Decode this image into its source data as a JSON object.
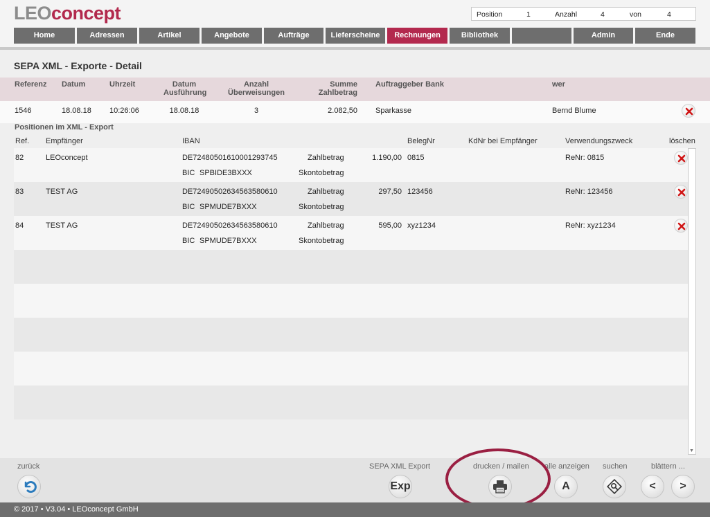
{
  "brand": {
    "leo": "LEO",
    "concept": "concept"
  },
  "info": {
    "position_label": "Position",
    "position_value": "1",
    "anzahl_label": "Anzahl",
    "anzahl_value": "4",
    "von_label": "von",
    "von_value": "4"
  },
  "nav": {
    "home": "Home",
    "adressen": "Adressen",
    "artikel": "Artikel",
    "angebote": "Angebote",
    "auftraege": "Aufträge",
    "lieferscheine": "Lieferscheine",
    "rechnungen": "Rechnungen",
    "bibliothek": "Bibliothek",
    "admin": "Admin",
    "ende": "Ende"
  },
  "page_title": "SEPA XML - Exporte - Detail",
  "export_header": {
    "referenz": "Referenz",
    "datum": "Datum",
    "uhrzeit": "Uhrzeit",
    "datum_ausfuehrung_1": "Datum",
    "datum_ausfuehrung_2": "Ausführung",
    "anzahl_1": "Anzahl",
    "anzahl_2": "Überweisungen",
    "summe_1": "Summe",
    "summe_2": "Zahlbetrag",
    "bank": "Auftraggeber Bank",
    "wer": "wer"
  },
  "export_row": {
    "referenz": "1546",
    "datum": "18.08.18",
    "uhrzeit": "10:26:06",
    "ausfuehrung": "18.08.18",
    "anzahl": "3",
    "summe": "2.082,50",
    "bank": "Sparkasse",
    "wer": "Bernd Blume"
  },
  "positions_title": "Positionen im XML - Export",
  "positions_header": {
    "ref": "Ref.",
    "empfaenger": "Empfänger",
    "iban": "IBAN",
    "belegnr": "BelegNr",
    "kdnr": "KdNr bei Empfänger",
    "verwendungszweck": "Verwendungszweck",
    "loeschen": "löschen"
  },
  "positions": [
    {
      "ref": "82",
      "empfaenger": "LEOconcept",
      "iban": "DE72480501610001293745",
      "bic_label": "BIC",
      "bic": "SPBIDE3BXXX",
      "zahlbetrag_label": "Zahlbetrag",
      "zahlbetrag": "1.190,00",
      "skonto_label": "Skontobetrag",
      "belegnr": "0815",
      "verwendungszweck": "ReNr: 0815"
    },
    {
      "ref": "83",
      "empfaenger": "TEST AG",
      "iban": "DE72490502634563580610",
      "bic_label": "BIC",
      "bic": "SPMUDE7BXXX",
      "zahlbetrag_label": "Zahlbetrag",
      "zahlbetrag": "297,50",
      "skonto_label": "Skontobetrag",
      "belegnr": "123456",
      "verwendungszweck": "ReNr: 123456"
    },
    {
      "ref": "84",
      "empfaenger": "TEST AG",
      "iban": "DE72490502634563580610",
      "bic_label": "BIC",
      "bic": "SPMUDE7BXXX",
      "zahlbetrag_label": "Zahlbetrag",
      "zahlbetrag": "595,00",
      "skonto_label": "Skontobetrag",
      "belegnr": "xyz1234",
      "verwendungszweck": "ReNr: xyz1234"
    }
  ],
  "footer": {
    "zurueck": "zurück",
    "sepa_export": "SEPA XML Export",
    "exp_btn": "Exp",
    "drucken": "drucken / mailen",
    "alle": "alle anzeigen",
    "alle_btn": "A",
    "suchen": "suchen",
    "blaettern": "blättern ...",
    "prev": "<",
    "next": ">"
  },
  "copyright": "© 2017 • V3.04 • LEOconcept GmbH",
  "colors": {
    "accent": "#b3294e",
    "nav": "#6e6e6e",
    "annotation": "#9a1f42"
  }
}
